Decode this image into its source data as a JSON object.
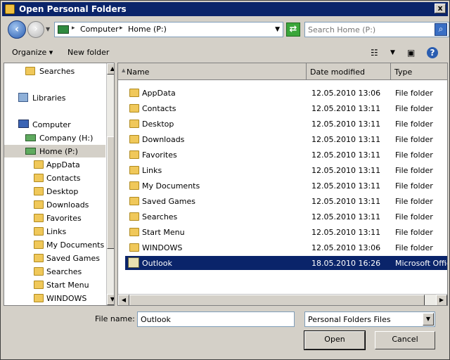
{
  "window": {
    "title": "Open Personal Folders",
    "close_label": "x"
  },
  "address": {
    "crumbs": [
      "Computer",
      "Home (P:)"
    ],
    "separator": "▸",
    "search_placeholder": "Search Home (P:)"
  },
  "toolbar": {
    "organize_label": "Organize ▾",
    "new_folder_label": "New folder"
  },
  "nav": {
    "items": [
      {
        "label": "Searches"
      },
      {
        "label": "Libraries"
      },
      {
        "label": "Computer"
      },
      {
        "label": "Company (H:)"
      },
      {
        "label": "Home (P:)"
      },
      {
        "label": "AppData"
      },
      {
        "label": "Contacts"
      },
      {
        "label": "Desktop"
      },
      {
        "label": "Downloads"
      },
      {
        "label": "Favorites"
      },
      {
        "label": "Links"
      },
      {
        "label": "My Documents"
      },
      {
        "label": "Saved Games"
      },
      {
        "label": "Searches"
      },
      {
        "label": "Start Menu"
      },
      {
        "label": "WINDOWS"
      }
    ]
  },
  "files": {
    "columns": [
      "Name",
      "Date modified",
      "Type"
    ],
    "rows": [
      {
        "name": "AppData",
        "date": "12.05.2010 13:06",
        "type": "File folder"
      },
      {
        "name": "Contacts",
        "date": "12.05.2010 13:11",
        "type": "File folder"
      },
      {
        "name": "Desktop",
        "date": "12.05.2010 13:11",
        "type": "File folder"
      },
      {
        "name": "Downloads",
        "date": "12.05.2010 13:11",
        "type": "File folder"
      },
      {
        "name": "Favorites",
        "date": "12.05.2010 13:11",
        "type": "File folder"
      },
      {
        "name": "Links",
        "date": "12.05.2010 13:11",
        "type": "File folder"
      },
      {
        "name": "My Documents",
        "date": "12.05.2010 13:11",
        "type": "File folder"
      },
      {
        "name": "Saved Games",
        "date": "12.05.2010 13:11",
        "type": "File folder"
      },
      {
        "name": "Searches",
        "date": "12.05.2010 13:11",
        "type": "File folder"
      },
      {
        "name": "Start Menu",
        "date": "12.05.2010 13:11",
        "type": "File folder"
      },
      {
        "name": "WINDOWS",
        "date": "12.05.2010 13:06",
        "type": "File folder"
      },
      {
        "name": "Outlook",
        "date": "18.05.2010 16:26",
        "type": "Microsoft Office"
      }
    ]
  },
  "footer": {
    "filename_label": "File name:",
    "filename_value": "Outlook",
    "filetype_value": "Personal Folders Files",
    "open_label": "Open",
    "cancel_label": "Cancel"
  }
}
